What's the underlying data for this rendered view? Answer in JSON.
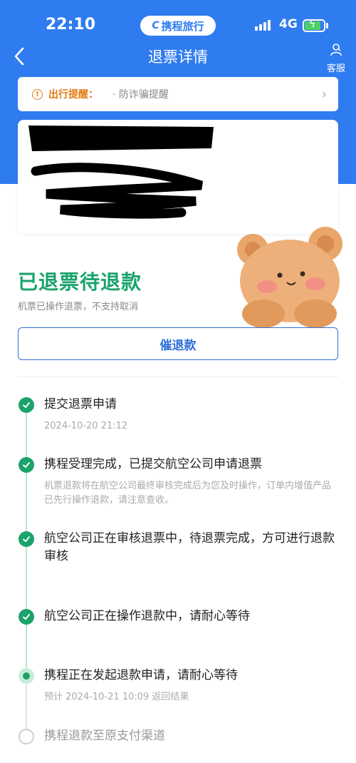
{
  "status_bar": {
    "time": "22:10",
    "brand": "携程旅行",
    "network": "4G"
  },
  "nav": {
    "title": "退票详情",
    "service_label": "客服"
  },
  "notice": {
    "label": "出行提醒：",
    "text": "· 防诈骗提醒"
  },
  "refund_status": {
    "title": "已退票待退款",
    "subtitle": "机票已操作退票，不支持取消",
    "urge_button": "催退款"
  },
  "timeline": [
    {
      "title": "提交退票申请",
      "subtitle": "2024-10-20 21:12",
      "state": "done"
    },
    {
      "title": "携程受理完成，已提交航空公司申请退票",
      "subtitle": "机票退款将在航空公司最终审核完成后为您及时操作，订单内增值产品已先行操作退款，请注意查收。",
      "state": "done"
    },
    {
      "title": "航空公司正在审核退票中，待退票完成，方可进行退款审核",
      "subtitle": "",
      "state": "done"
    },
    {
      "title": "航空公司正在操作退款中，请耐心等待",
      "subtitle": "",
      "state": "done"
    },
    {
      "title": "携程正在发起退款申请，请耐心等待",
      "subtitle": "预计 2024-10-21 10:09 返回结果",
      "state": "current"
    },
    {
      "title": "携程退款至原支付渠道",
      "subtitle": "",
      "state": "pending"
    }
  ],
  "colors": {
    "brand_blue": "#2f7cf0",
    "success_green": "#1aa36a",
    "notice_orange": "#e27b14"
  }
}
